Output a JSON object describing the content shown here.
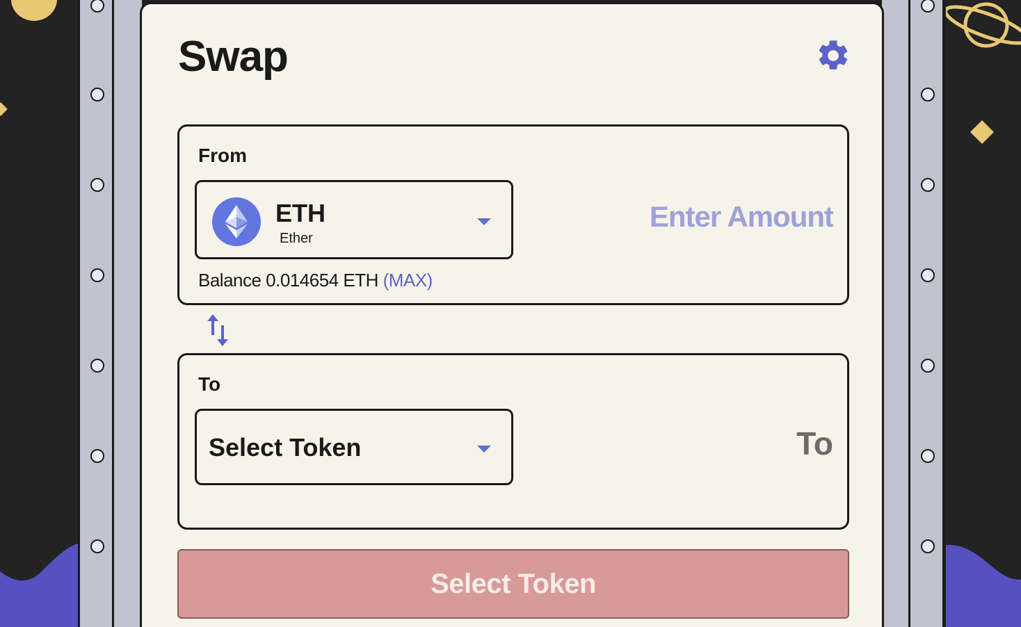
{
  "swap": {
    "title": "Swap",
    "settings_icon": "gear-icon",
    "from": {
      "label": "From",
      "token_symbol": "ETH",
      "token_name": "Ether",
      "token_icon": "ethereum-logo-icon",
      "amount_placeholder": "Enter Amount",
      "balance_text": "Balance 0.014654 ETH",
      "max_label": "(MAX)"
    },
    "switch_icon": "swap-arrows-icon",
    "to": {
      "label": "To",
      "token_select_label": "Select Token",
      "amount_display": "To"
    },
    "action_button_label": "Select Token"
  },
  "colors": {
    "card_bg": "#f6f3ea",
    "accent": "#6276e0",
    "placeholder": "#9fa2d6",
    "button_disabled": "#d89a96",
    "background": "#232323",
    "wave": "#5750c0",
    "decoration": "#e8c872"
  }
}
